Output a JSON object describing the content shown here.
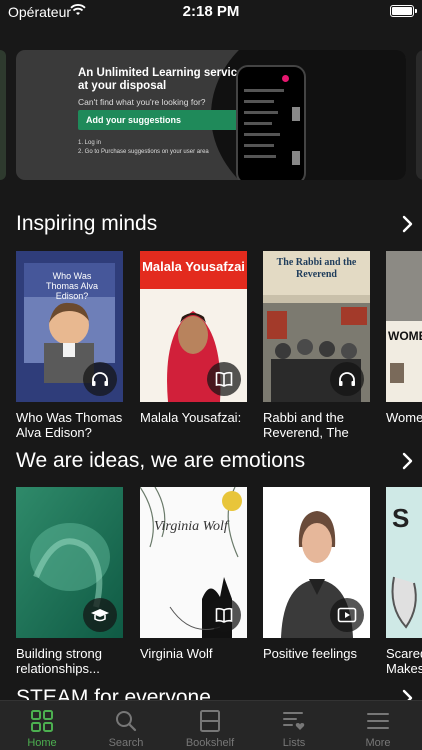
{
  "status_bar": {
    "carrier": "Opérateur",
    "time": "2:18 PM"
  },
  "banner": {
    "title": "An Unlimited Learning service at your disposal",
    "subtitle": "Can't find what you're looking for?",
    "cta_label": "Add your suggestions",
    "step1": "1. Log in",
    "step2": "2. Go to Purchase suggestions on your user area"
  },
  "sections": [
    {
      "title": "Inspiring minds",
      "items": [
        {
          "caption": "Who Was Thomas Alva Edison?",
          "cover_text": "Who Was Thomas Alva Edison?",
          "badge": "headphones-icon"
        },
        {
          "caption": "Malala Yousafzai:",
          "cover_text": "Malala Yousafzai",
          "badge": "book-icon"
        },
        {
          "caption": "Rabbi and the Reverend, The",
          "cover_text": "The Rabbi and the Reverend",
          "badge": "headphones-icon"
        },
        {
          "caption": "Wome",
          "cover_text": "WOME",
          "badge": ""
        }
      ]
    },
    {
      "title": "We are ideas, we are emotions",
      "items": [
        {
          "caption": "Building strong relationships...",
          "cover_text": "",
          "badge": "graduation-cap-icon"
        },
        {
          "caption": "Virginia Wolf",
          "cover_text": "Virginia Wolf",
          "badge": "book-icon"
        },
        {
          "caption": "Positive feelings",
          "cover_text": "",
          "badge": "play-icon"
        },
        {
          "caption": "Scared Makes",
          "cover_text": "S",
          "badge": ""
        }
      ]
    },
    {
      "title": "STEAM for everyone"
    }
  ],
  "tabs": [
    {
      "label": "Home",
      "icon": "home-grid-icon",
      "active": true
    },
    {
      "label": "Search",
      "icon": "search-icon",
      "active": false
    },
    {
      "label": "Bookshelf",
      "icon": "bookshelf-icon",
      "active": false
    },
    {
      "label": "Lists",
      "icon": "lists-icon",
      "active": false
    },
    {
      "label": "More",
      "icon": "menu-icon",
      "active": false
    }
  ],
  "colors": {
    "accent": "#4caf50",
    "background": "#181818",
    "cta": "#1f8a5a"
  }
}
